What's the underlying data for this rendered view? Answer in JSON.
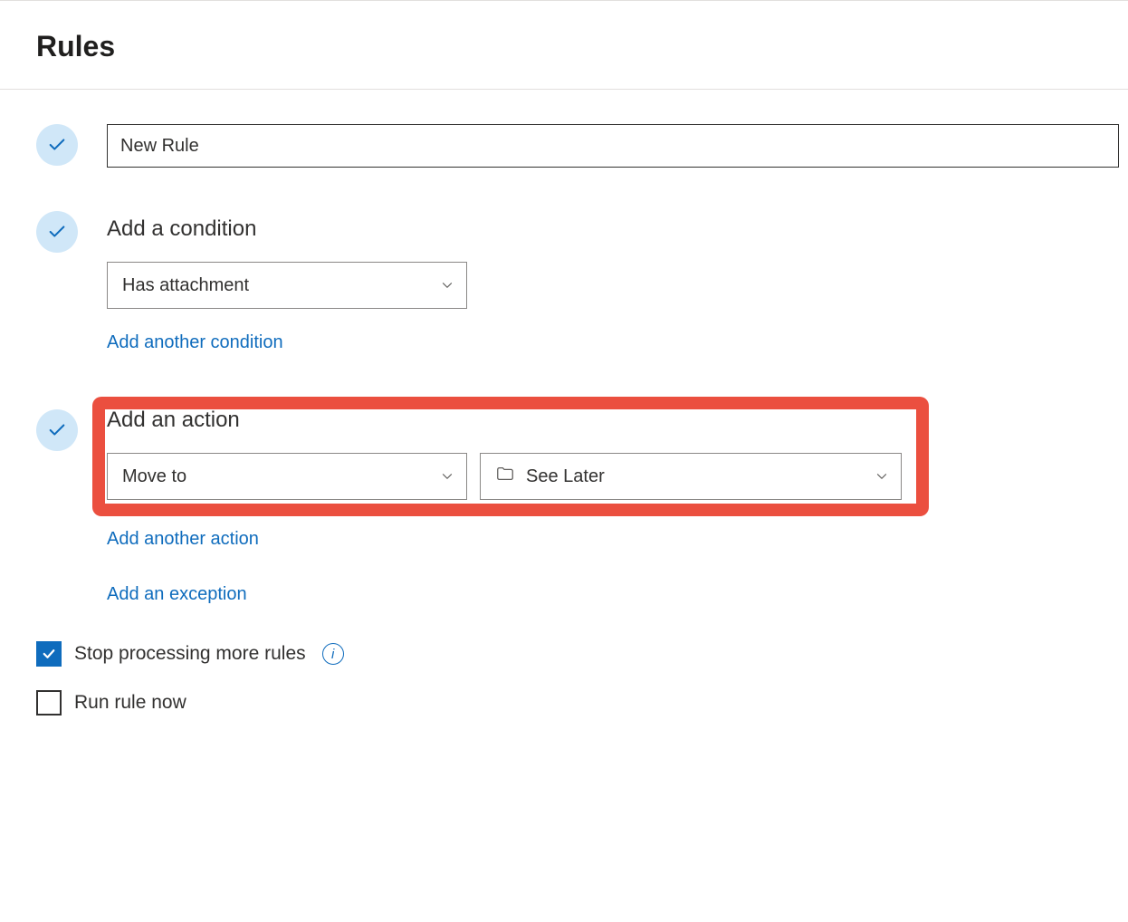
{
  "page_title": "Rules",
  "rule_name": {
    "value": "New Rule"
  },
  "condition": {
    "heading": "Add a condition",
    "selected": "Has attachment",
    "add_another": "Add another condition"
  },
  "action": {
    "heading": "Add an action",
    "type_selected": "Move to",
    "folder_selected": "See Later",
    "add_another": "Add another action",
    "add_exception": "Add an exception"
  },
  "options": {
    "stop_processing_label": "Stop processing more rules",
    "stop_processing_checked": true,
    "run_now_label": "Run rule now",
    "run_now_checked": false
  },
  "colors": {
    "accent": "#0f6cbd",
    "highlight": "#eb4f3f",
    "badge": "#d0e7f8"
  }
}
